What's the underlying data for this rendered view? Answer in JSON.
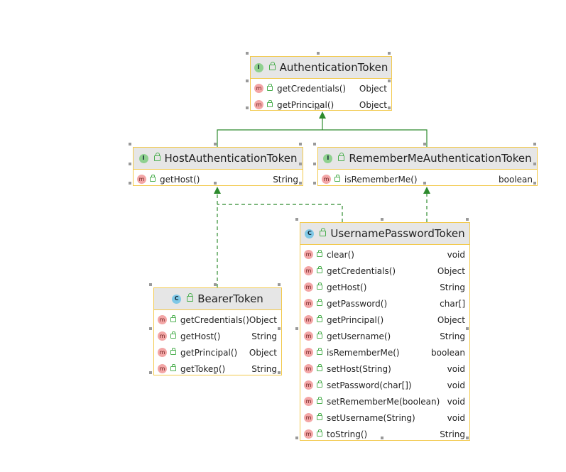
{
  "nodes": {
    "authentication_token": {
      "title": "AuthenticationToken",
      "kind": "interface",
      "badge": "I",
      "members": [
        {
          "name": "getCredentials()",
          "type": "Object"
        },
        {
          "name": "getPrincipal()",
          "type": "Object"
        }
      ]
    },
    "host_authentication_token": {
      "title": "HostAuthenticationToken",
      "kind": "interface",
      "badge": "I",
      "members": [
        {
          "name": "getHost()",
          "type": "String"
        }
      ]
    },
    "remember_me_authentication_token": {
      "title": "RememberMeAuthenticationToken",
      "kind": "interface",
      "badge": "I",
      "members": [
        {
          "name": "isRememberMe()",
          "type": "boolean"
        }
      ]
    },
    "username_password_token": {
      "title": "UsernamePasswordToken",
      "kind": "class",
      "badge": "C",
      "members": [
        {
          "name": "clear()",
          "type": "void"
        },
        {
          "name": "getCredentials()",
          "type": "Object"
        },
        {
          "name": "getHost()",
          "type": "String"
        },
        {
          "name": "getPassword()",
          "type": "char[]"
        },
        {
          "name": "getPrincipal()",
          "type": "Object"
        },
        {
          "name": "getUsername()",
          "type": "String"
        },
        {
          "name": "isRememberMe()",
          "type": "boolean"
        },
        {
          "name": "setHost(String)",
          "type": "void"
        },
        {
          "name": "setPassword(char[])",
          "type": "void"
        },
        {
          "name": "setRememberMe(boolean)",
          "type": "void"
        },
        {
          "name": "setUsername(String)",
          "type": "void"
        },
        {
          "name": "toString()",
          "type": "String"
        }
      ]
    },
    "bearer_token": {
      "title": "BearerToken",
      "kind": "class",
      "badge": "C",
      "members": [
        {
          "name": "getCredentials()",
          "type": "Object"
        },
        {
          "name": "getHost()",
          "type": "String"
        },
        {
          "name": "getPrincipal()",
          "type": "Object"
        },
        {
          "name": "getToken()",
          "type": "String"
        }
      ]
    }
  },
  "member_badge": "m",
  "relations": [
    {
      "from": "host_authentication_token",
      "to": "authentication_token",
      "style": "extends"
    },
    {
      "from": "remember_me_authentication_token",
      "to": "authentication_token",
      "style": "extends"
    },
    {
      "from": "bearer_token",
      "to": "host_authentication_token",
      "style": "implements"
    },
    {
      "from": "username_password_token",
      "to": "host_authentication_token",
      "style": "implements"
    },
    {
      "from": "username_password_token",
      "to": "remember_me_authentication_token",
      "style": "implements"
    }
  ],
  "colors": {
    "border": "#f2c94c",
    "header": "#e6e6e6",
    "edge": "#2e8b2e",
    "interface_badge": "#8fd18f",
    "class_badge": "#7fc8e6",
    "method_badge": "#f3a6a6"
  }
}
